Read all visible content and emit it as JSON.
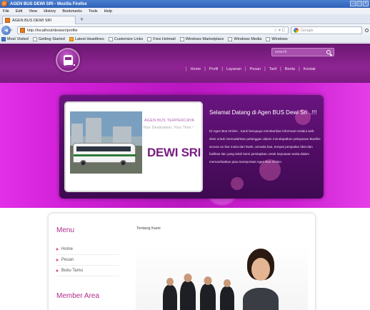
{
  "browser": {
    "window_title": "AGEN BUS DEWI SRI - Mozilla Firefox",
    "menu": [
      "File",
      "Edit",
      "View",
      "History",
      "Bookmarks",
      "Tools",
      "Help"
    ],
    "tab_label": "AGEN BUS DEWI SRI",
    "new_tab": "+",
    "url": "http://localhost/dewisri/profile",
    "search_placeholder": "Google",
    "bookmarks": [
      "Most Visited",
      "Getting Started",
      "Latest Headlines",
      "Customize Links",
      "Free Hotmail",
      "Windows Marketplace",
      "Windows Media",
      "Windows"
    ]
  },
  "site": {
    "search_placeholder": "search",
    "nav": [
      "Home",
      "Profil",
      "Layanan",
      "Pesan",
      "Tarif",
      "Berita",
      "Kontak"
    ],
    "slide": {
      "tagline": "AGEN BUS TERPERCAYA",
      "subtagline": "Your Destination, Your Time !",
      "brand": "DEWI SRI",
      "title": "Selamat Datang di Agen BUS Dewi Sri ..!!!",
      "body": "Di Agen Bus Online , Kami berupaya memberikan informasi melalui web sites untuk memudahkan pelanggan dalam mendapatkan pelayanan Bus/bis secara on line mulai dari tiwek, armada bus, tempat penjualan tiket dan fasilitas lain yang telah kami persiapkan untuk kepuasan anda dalam memanfaatkan jasa transportasi Agen Bus Online."
    },
    "sidebar": {
      "menu_title": "Menu",
      "items": [
        "Home",
        "Pesan",
        "Buku Tamu"
      ],
      "member_title": "Member Area"
    },
    "main": {
      "section_label": "Tentang Kami"
    }
  },
  "colors": {
    "header": "#8e2492",
    "banner": "#cf1fd6",
    "heading": "#b22a8a",
    "brand": "#7a1c82"
  }
}
